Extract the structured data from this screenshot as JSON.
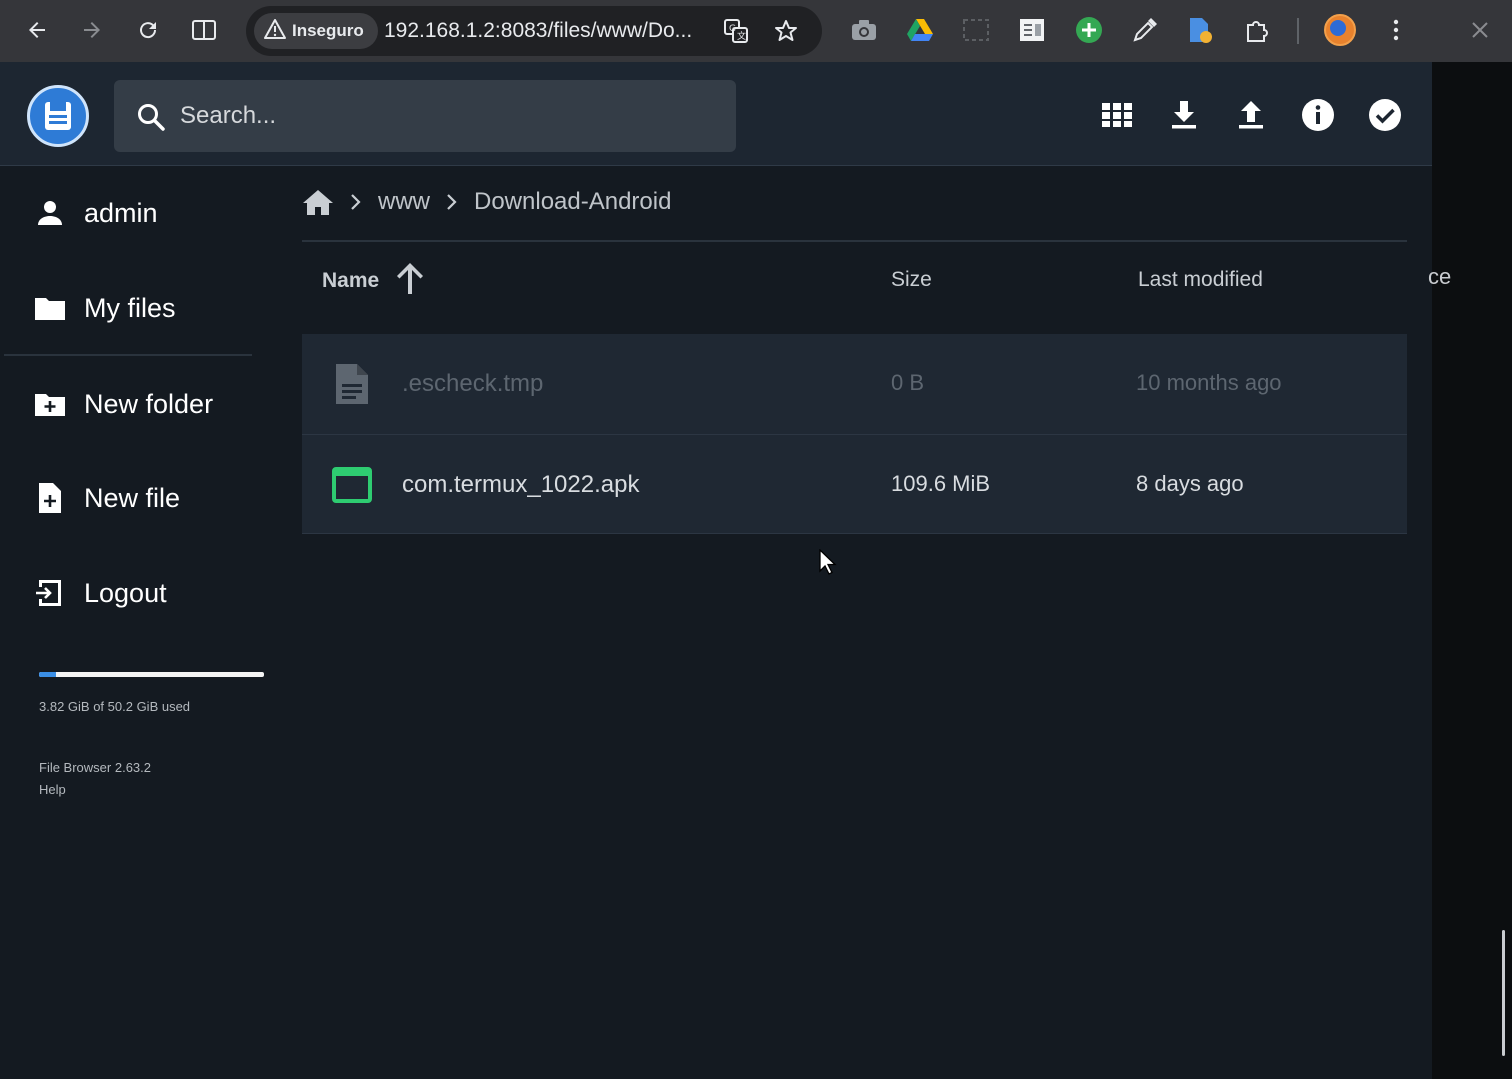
{
  "browser": {
    "security_label": "Inseguro",
    "url": "192.168.1.2:8083/files/www/Do..."
  },
  "app": {
    "search_placeholder": "Search...",
    "user": "admin",
    "nav": {
      "my_files": "My files",
      "new_folder": "New folder",
      "new_file": "New file",
      "logout": "Logout"
    },
    "usage": {
      "text": "3.82 GiB of 50.2 GiB used",
      "fraction": 0.076
    },
    "version": "File Browser 2.63.2",
    "help": "Help"
  },
  "breadcrumb": [
    "www",
    "Download-Android"
  ],
  "table": {
    "columns": {
      "name": "Name",
      "size": "Size",
      "modified": "Last modified"
    },
    "rows": [
      {
        "name": ".escheck.tmp",
        "size": "0 B",
        "modified": "10 months ago",
        "icon": "file-icon"
      },
      {
        "name": "com.termux_1022.apk",
        "size": "109.6 MiB",
        "modified": "8 days ago",
        "icon": "apk-icon"
      }
    ]
  },
  "colors": {
    "accent": "#3b8fe6",
    "apk_green": "#2ecc71",
    "background": "#141a21",
    "header": "#1d2631"
  },
  "stray_text": "ce"
}
